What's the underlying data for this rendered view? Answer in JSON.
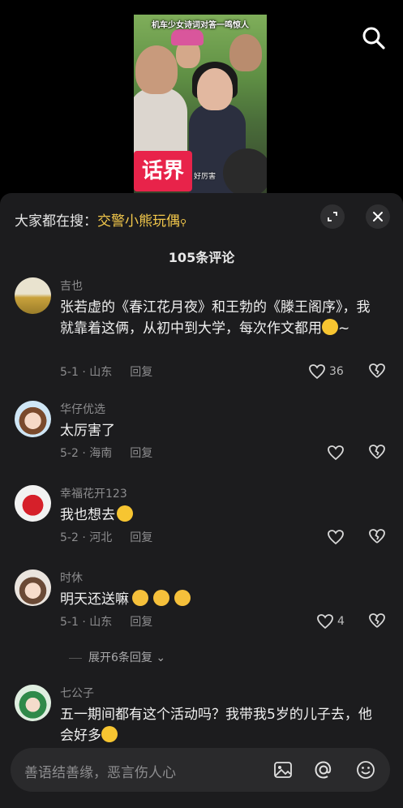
{
  "video": {
    "caption": "机车少女诗词对答一鸣惊人",
    "sign_text": "话界",
    "sub_text": "好厉害"
  },
  "header": {
    "hot_search_prefix": "大家都在搜：",
    "hot_search_keyword": "交警小熊玩偶",
    "comment_count_title": "105条评论"
  },
  "comments": [
    {
      "username": "吉也",
      "text_before": "张若虚的《春江花月夜》和王勃的《滕王阁序》，我就靠着这俩，从初中到大学，每次作文都用",
      "text_after": "~",
      "date_location": "5-1 · 山东",
      "reply_label": "回复",
      "likes": "36"
    },
    {
      "username": "华仔优选",
      "text": "太厉害了",
      "date_location": "5-2 · 海南",
      "reply_label": "回复",
      "likes": ""
    },
    {
      "username": "幸福花开123",
      "text": "我也想去",
      "date_location": "5-2 · 河北",
      "reply_label": "回复",
      "likes": ""
    },
    {
      "username": "时休",
      "text": "明天还送嘛",
      "date_location": "5-1 · 山东",
      "reply_label": "回复",
      "likes": "4"
    },
    {
      "username": "七公子",
      "text_before": "五一期间都有这个活动吗？我带我5岁的儿子去，他会好多",
      "text_after": "",
      "date_location": "",
      "reply_label": ""
    }
  ],
  "expand_replies_label": "展开6条回复",
  "input": {
    "placeholder": "善语结善缘，恶言伤人心"
  },
  "colors": {
    "panel_bg": "#1c1c1e",
    "keyword": "#f3c84b",
    "muted_text": "#8c8c8e"
  }
}
